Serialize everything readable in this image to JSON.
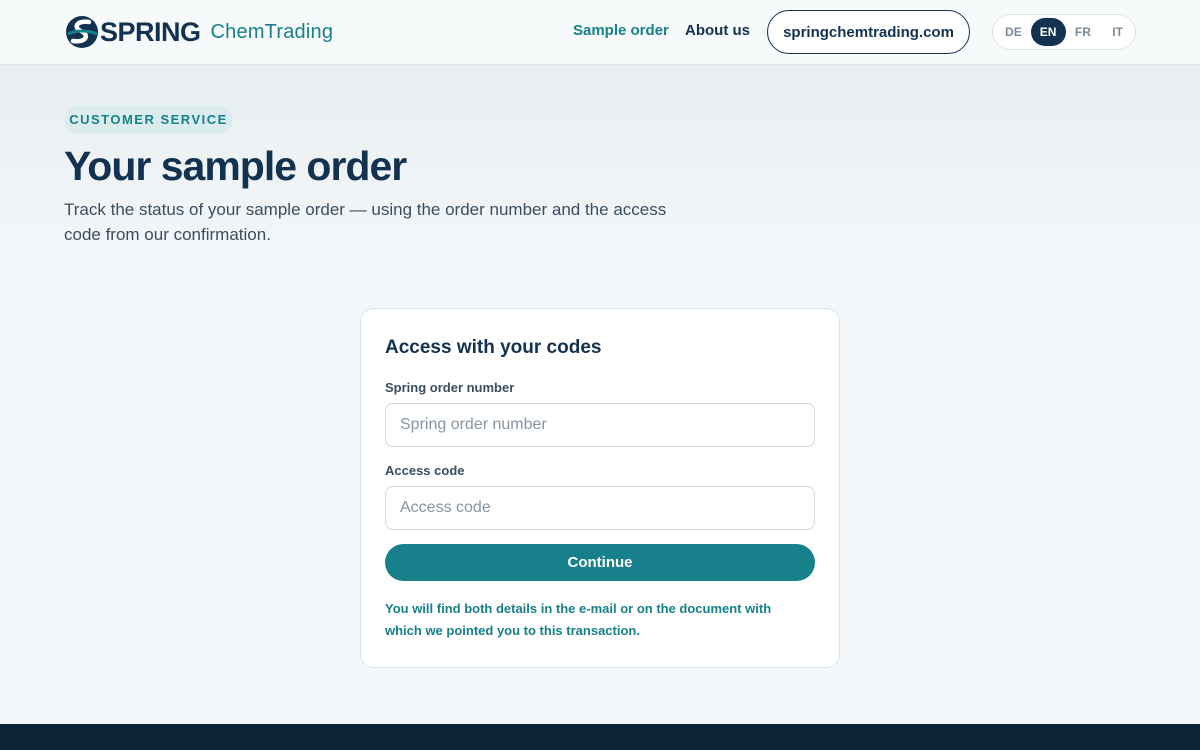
{
  "header": {
    "logo_word": "SPRING",
    "logo_sub": "ChemTrading",
    "nav": {
      "sample_order": "Sample order",
      "about_us": "About us"
    },
    "site_button": "springchemtrading.com",
    "languages": [
      "DE",
      "EN",
      "FR",
      "IT"
    ],
    "active_language": "EN"
  },
  "hero": {
    "eyebrow": "CUSTOMER SERVICE",
    "title": "Your sample order",
    "lead": "Track the status of your sample order — using the order number and the access code from our confirmation."
  },
  "form": {
    "title": "Access with your codes",
    "order_label": "Spring order number",
    "order_placeholder": "Spring order number",
    "order_value": "",
    "code_label": "Access code",
    "code_placeholder": "Access code",
    "code_value": "",
    "submit_label": "Continue",
    "help": "You will find both details in the e-mail or on the document with which we pointed you to this transaction."
  },
  "colors": {
    "navy": "#12324f",
    "teal": "#17808a",
    "background": "#f4f7f9",
    "footer": "#0d2438"
  }
}
